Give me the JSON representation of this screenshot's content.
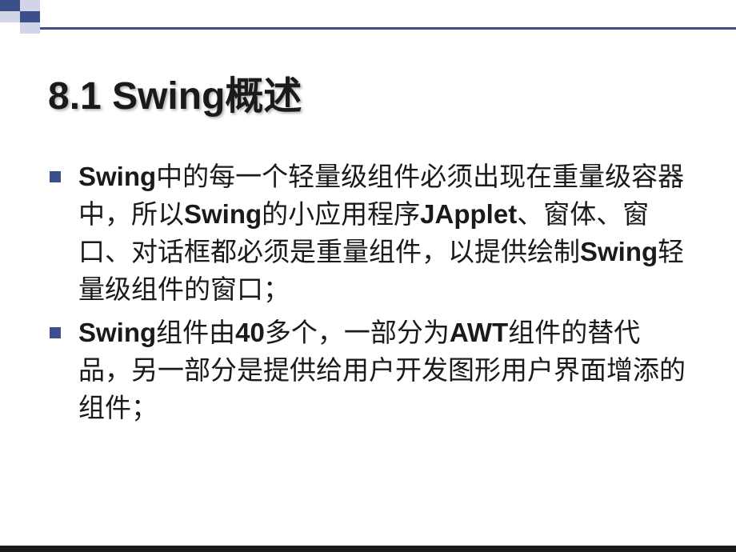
{
  "slide": {
    "title": "8.1 Swing概述",
    "bullets": [
      {
        "parts": [
          {
            "text": "Swing",
            "bold": true
          },
          {
            "text": "中的每一个轻量级组件必须出现在重量级容器中，所以",
            "bold": false
          },
          {
            "text": "Swing",
            "bold": true
          },
          {
            "text": "的小应用程序",
            "bold": false
          },
          {
            "text": "JApplet",
            "bold": true
          },
          {
            "text": "、窗体、窗口、对话框都必须是重量组件，以提供绘制",
            "bold": false
          },
          {
            "text": "Swing",
            "bold": true
          },
          {
            "text": "轻量级组件的窗口；",
            "bold": false
          }
        ]
      },
      {
        "parts": [
          {
            "text": "Swing",
            "bold": true
          },
          {
            "text": "组件由",
            "bold": false
          },
          {
            "text": "40",
            "bold": true
          },
          {
            "text": "多个，一部分为",
            "bold": false
          },
          {
            "text": "AWT",
            "bold": true
          },
          {
            "text": "组件的替代品，另一部分是提供给用户开发图形用户界面增添的组件；",
            "bold": false
          }
        ]
      }
    ]
  }
}
